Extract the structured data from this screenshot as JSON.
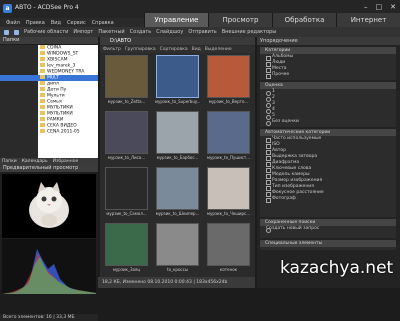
{
  "app": {
    "title": "ABTO - ACDSee Pro 4",
    "icon": "a"
  },
  "menu": [
    "Файл",
    "Правка",
    "Вид",
    "Сервис",
    "Справка"
  ],
  "modes": [
    "Управление",
    "Просмотр",
    "Обработка",
    "Интернет"
  ],
  "toolbar": [
    "Рабочие области",
    "Импорт",
    "Пакетный",
    "Создать",
    "Слайдшоу",
    "Отправить",
    "Внешние редакторы"
  ],
  "left": {
    "folders_title": "Папки",
    "tree": [
      "CDINA",
      "WINDOWS_ST",
      "XBISCAM",
      "lev_marek_3",
      "WEDMONEY TRA",
      "MULT",
      "дипл",
      "Дети Пу",
      "Мульти",
      "Семья",
      "МУЛЬТИКИ",
      "МУЛЬТИКИ",
      "РАМКИ",
      "CEKA ВИДЕО",
      "CENA 2011-05"
    ],
    "tabs": [
      "Папки",
      "Календарь",
      "Избранное"
    ],
    "preview_title": "Предварительный просмотр",
    "status": "Всего элементов: 16 | 33,3 МБ"
  },
  "center": {
    "path": "D:\\ABTO",
    "filters": [
      "Фильтр",
      "Группировка",
      "Сортировка",
      "Вид",
      "Выделение"
    ],
    "items": [
      "мурзик_to_Zetta...",
      "мурзик_to_Superbuy...",
      "мурзик_to_Верто...",
      "мурзик_to_Лиса...",
      "мурзик_to_Барбос...",
      "мурзик_to_Пушист...",
      "мурзик_to_Самол...",
      "мурзик_to_Шкипер...",
      "мурзик_to_Чеширс...",
      "мурзик_Заяц",
      "to_кроссы",
      "котенок"
    ],
    "status": "18,2 КБ, Изменено 08.10.2010 0:00:43 | 183x456x24b"
  },
  "right": {
    "title": "Упорядочение",
    "sec1": "Категории",
    "cats": [
      "Альбомы",
      "Люди",
      "Места",
      "Прочее"
    ],
    "sec2": "Оценка",
    "ratings": [
      "1",
      "2",
      "3",
      "4",
      "5",
      "Без оценки"
    ],
    "sec3": "Автоматические категории",
    "auto": [
      "Часто используемые",
      "ISO",
      "Автор",
      "Выдержка затвора",
      "Диафрагма",
      "Ключевые слова",
      "Модель камеры",
      "Размер изображения",
      "Тип изображения",
      "Фокусное расстояние",
      "Фотограф"
    ],
    "saved": "Сохраненные поиски",
    "newsearch": "Создать новый запрос",
    "sec4": "Специальные элементы"
  },
  "watermark": "kazachya.net"
}
